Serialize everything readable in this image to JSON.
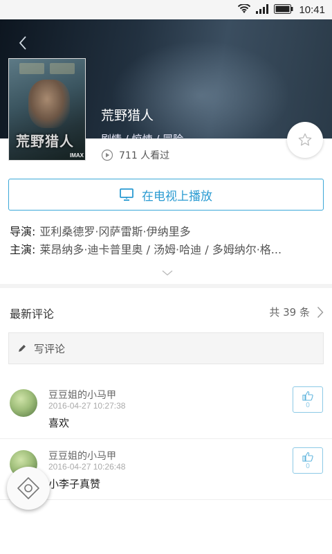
{
  "status_bar": {
    "time": "10:41"
  },
  "movie": {
    "title": "荒野猎人",
    "genres": "剧情 / 惊悚 / 冒险",
    "watch_count": "711 人看过",
    "poster_title": "荒野猎人",
    "poster_brand": "IMAX"
  },
  "actions": {
    "play_on_tv": "在电视上播放"
  },
  "credits": {
    "director_label": "导演:",
    "director": "亚利桑德罗·冈萨雷斯·伊纳里多",
    "cast_label": "主演:",
    "cast": "莱昂纳多·迪卡普里奥 / 汤姆·哈迪 / 多姆纳尔·格..."
  },
  "comments_section": {
    "title": "最新评论",
    "count": "共 39 条",
    "write_label": "写评论",
    "items": [
      {
        "user": "豆豆姐的小马甲",
        "date": "2016-04-27 10:27:38",
        "text": "喜欢",
        "likes": "0"
      },
      {
        "user": "豆豆姐的小马甲",
        "date": "2016-04-27 10:26:48",
        "text": "小李子真赞",
        "likes": "0"
      }
    ]
  },
  "colors": {
    "accent": "#2a9bd2",
    "like_border": "#8cc9e6"
  }
}
